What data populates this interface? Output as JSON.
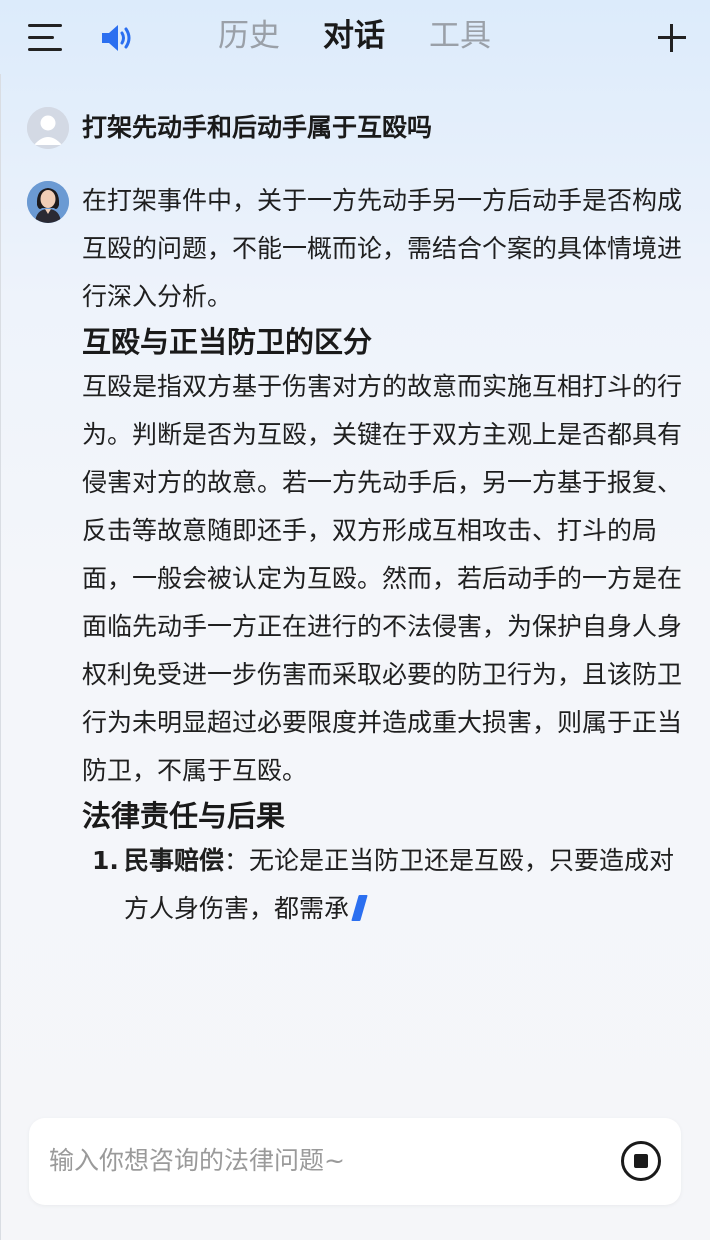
{
  "header": {
    "tabs": [
      {
        "label": "历史",
        "active": false
      },
      {
        "label": "对话",
        "active": true
      },
      {
        "label": "工具",
        "active": false
      }
    ],
    "icons": {
      "menu": "menu-icon",
      "speaker": "speaker-icon",
      "new_chat": "plus-icon"
    }
  },
  "conversation": {
    "question": "打架先动手和后动手属于互殴吗",
    "answer": {
      "intro": "在打架事件中，关于一方先动手另一方后动手是否构成互殴的问题，不能一概而论，需结合个案的具体情境进行深入分析。",
      "section1_title": "互殴与正当防卫的区分",
      "section1_body": "互殴是指双方基于伤害对方的故意而实施互相打斗的行为。判断是否为互殴，关键在于双方主观上是否都具有侵害对方的故意。若一方先动手后，另一方基于报复、反击等故意随即还手，双方形成互相攻击、打斗的局面，一般会被认定为互殴。然而，若后动手的一方是在面临先动手一方正在进行的不法侵害，为保护自身人身权利免受进一步伤害而采取必要的防卫行为，且该防卫行为未明显超过必要限度并造成重大损害，则属于正当防卫，不属于互殴。",
      "section2_title": "法律责任与后果",
      "list": [
        {
          "num": "1.",
          "title": "民事赔偿",
          "text": "：无论是正当防卫还是互殴，只要造成对方人身伤害，都需承"
        }
      ]
    }
  },
  "input": {
    "placeholder": "输入你想咨询的法律问题~",
    "value": ""
  },
  "colors": {
    "accent": "#2b6ff0",
    "speaker": "#2b6ff0"
  }
}
